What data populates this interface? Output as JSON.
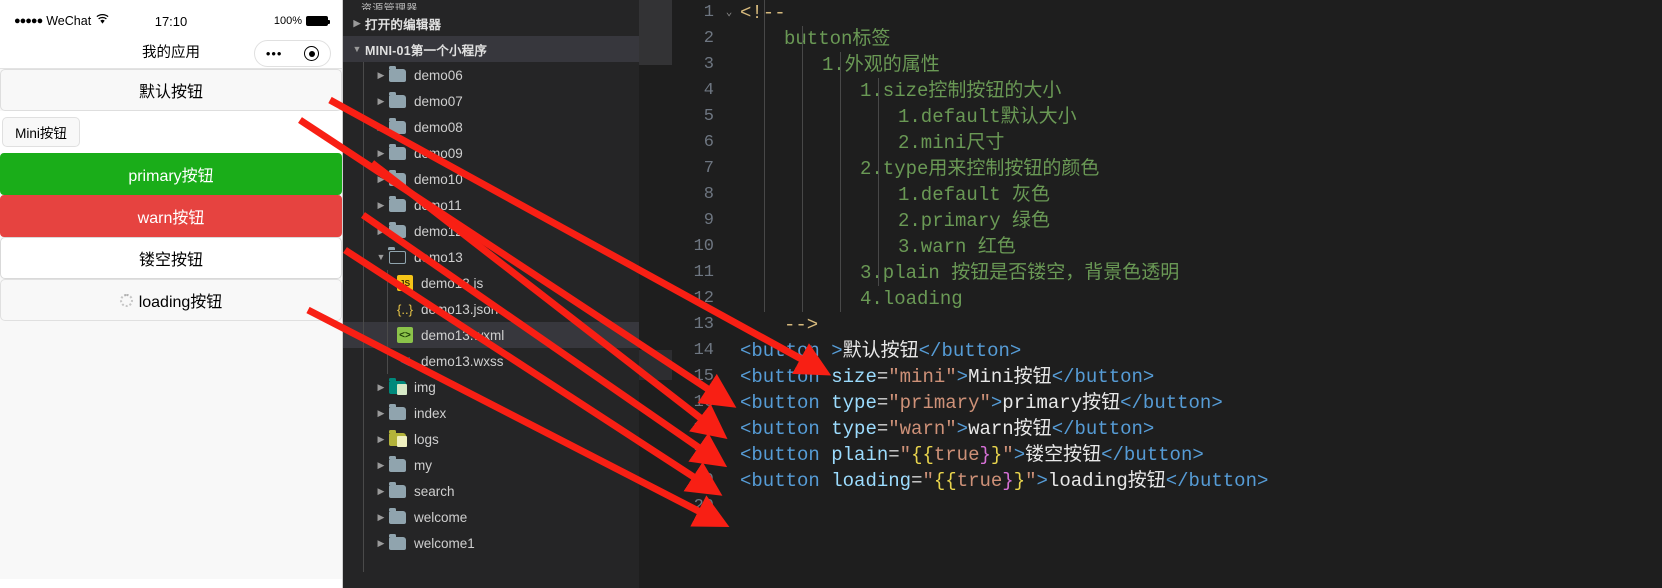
{
  "simulator": {
    "status_bar": {
      "signal_dots": "●●●●●",
      "carrier": "WeChat",
      "wifi_icon": "wifi-icon",
      "time": "17:10",
      "battery_percent": "100%"
    },
    "nav": {
      "title": "我的应用",
      "capsule_more": "•••",
      "capsule_target": "target-icon"
    },
    "buttons": [
      {
        "name": "default",
        "label": "默认按钮",
        "style": "default-btn"
      },
      {
        "name": "mini",
        "label": "Mini按钮",
        "style": "mini"
      },
      {
        "name": "primary",
        "label": "primary按钮",
        "style": "primary"
      },
      {
        "name": "warn",
        "label": "warn按钮",
        "style": "warn"
      },
      {
        "name": "plain",
        "label": "镂空按钮",
        "style": "plain"
      },
      {
        "name": "loading",
        "label": "loading按钮",
        "style": "loading"
      }
    ]
  },
  "explorer": {
    "panel_title": "资源管理器",
    "sections": [
      {
        "label": "打开的编辑器",
        "expanded": false
      },
      {
        "label": "MINI-01第一个小程序",
        "expanded": true
      }
    ],
    "tree": [
      {
        "label": "demo06",
        "type": "folder",
        "expanded": false,
        "depth": 1,
        "icon": "folder-icon"
      },
      {
        "label": "demo07",
        "type": "folder",
        "expanded": false,
        "depth": 1,
        "icon": "folder-icon"
      },
      {
        "label": "demo08",
        "type": "folder",
        "expanded": false,
        "depth": 1,
        "icon": "folder-icon"
      },
      {
        "label": "demo09",
        "type": "folder",
        "expanded": false,
        "depth": 1,
        "icon": "folder-icon"
      },
      {
        "label": "demo10",
        "type": "folder",
        "expanded": false,
        "depth": 1,
        "icon": "folder-icon"
      },
      {
        "label": "demo11",
        "type": "folder",
        "expanded": false,
        "depth": 1,
        "icon": "folder-icon"
      },
      {
        "label": "demo12",
        "type": "folder",
        "expanded": false,
        "depth": 1,
        "icon": "folder-icon"
      },
      {
        "label": "demo13",
        "type": "folder",
        "expanded": true,
        "depth": 1,
        "icon": "folder-open-icon"
      },
      {
        "label": "demo13.js",
        "type": "file",
        "filetype": "js",
        "depth": 2,
        "icon": "js-file-icon"
      },
      {
        "label": "demo13.json",
        "type": "file",
        "filetype": "json",
        "depth": 2,
        "icon": "json-file-icon"
      },
      {
        "label": "demo13.wxml",
        "type": "file",
        "filetype": "wxml",
        "depth": 2,
        "icon": "wxml-file-icon",
        "selected": true
      },
      {
        "label": "demo13.wxss",
        "type": "file",
        "filetype": "wxss",
        "depth": 2,
        "icon": "wxss-file-icon"
      },
      {
        "label": "img",
        "type": "folder",
        "expanded": false,
        "depth": 1,
        "icon": "folder-image-icon"
      },
      {
        "label": "index",
        "type": "folder",
        "expanded": false,
        "depth": 1,
        "icon": "folder-icon"
      },
      {
        "label": "logs",
        "type": "folder",
        "expanded": false,
        "depth": 1,
        "icon": "folder-log-icon"
      },
      {
        "label": "my",
        "type": "folder",
        "expanded": false,
        "depth": 1,
        "icon": "folder-icon"
      },
      {
        "label": "search",
        "type": "folder",
        "expanded": false,
        "depth": 1,
        "icon": "folder-icon"
      },
      {
        "label": "welcome",
        "type": "folder",
        "expanded": false,
        "depth": 1,
        "icon": "folder-icon"
      },
      {
        "label": "welcome1",
        "type": "folder",
        "expanded": false,
        "depth": 1,
        "icon": "folder-icon"
      }
    ]
  },
  "editor": {
    "lines": [
      {
        "n": "1",
        "fold": "v"
      },
      {
        "n": "2",
        "fold": ""
      },
      {
        "n": "3",
        "fold": ""
      },
      {
        "n": "4",
        "fold": ""
      },
      {
        "n": "5",
        "fold": ""
      },
      {
        "n": "6",
        "fold": ""
      },
      {
        "n": "7",
        "fold": ""
      },
      {
        "n": "8",
        "fold": ""
      },
      {
        "n": "9",
        "fold": ""
      },
      {
        "n": "10",
        "fold": ""
      },
      {
        "n": "11",
        "fold": ""
      },
      {
        "n": "12",
        "fold": ""
      },
      {
        "n": "13",
        "fold": ""
      },
      {
        "n": "14",
        "fold": ""
      },
      {
        "n": "15",
        "fold": ""
      },
      {
        "n": "16",
        "fold": ""
      },
      {
        "n": "17",
        "fold": ""
      },
      {
        "n": "18",
        "fold": ""
      },
      {
        "n": "19",
        "fold": ""
      },
      {
        "n": "20",
        "fold": ""
      }
    ],
    "code": {
      "l1": "<!--",
      "l2": "button标签",
      "l3": "1.外观的属性",
      "l4": "1.size控制按钮的大小",
      "l5": "1.default默认大小",
      "l6": "2.mini尺寸",
      "l7": "2.type用来控制按钮的颜色",
      "l8": "1.default 灰色",
      "l9": "2.primary 绿色",
      "l10": "3.warn 红色",
      "l11": "3.plain 按钮是否镂空，背景色透明",
      "l12": "4.loading",
      "l13": "-->",
      "l14_tag_open": "<button",
      "l14_gt": ">",
      "l14_text": "默认按钮",
      "l14_close": "</button>",
      "l15_tag_open": "<button",
      "l15_attr": "size",
      "l15_eq": "=",
      "l15_val": "\"mini\"",
      "l15_gt": ">",
      "l15_text": "Mini按钮",
      "l15_close": "</button>",
      "l16_tag_open": "<button",
      "l16_attr": "type",
      "l16_eq": "=",
      "l16_val": "\"primary\"",
      "l16_gt": ">",
      "l16_text": "primary按钮",
      "l16_close": "</button>",
      "l17_tag_open": "<button",
      "l17_attr": "type",
      "l17_eq": "=",
      "l17_val": "\"warn\"",
      "l17_gt": ">",
      "l17_text": "warn按钮",
      "l17_close": "</button>",
      "l18_tag_open": "<button",
      "l18_attr": "plain",
      "l18_eq": "=",
      "l18_q1": "\"",
      "l18_b1": "{{",
      "l18_v": "true",
      "l18_b2": "}",
      "l18_b3": "}",
      "l18_q2": "\"",
      "l18_gt": ">",
      "l18_text": "镂空按钮",
      "l18_close": "</button>",
      "l19_tag_open": "<button",
      "l19_attr": "loading",
      "l19_eq": "=",
      "l19_q1": "\"",
      "l19_b1": "{{",
      "l19_v": "true",
      "l19_b2": "}",
      "l19_b3": "}",
      "l19_q2": "\"",
      "l19_gt": ">",
      "l19_text": "loading按钮",
      "l19_close": "</button>"
    }
  },
  "annotations": {
    "arrow_color": "#f81f14",
    "count": 6,
    "description": "红色箭头，从代码行指向模拟器中对应的按钮"
  },
  "colors": {
    "primary_green": "#1aad19",
    "warn_red": "#e64340",
    "editor_bg": "#1e1e1e",
    "explorer_bg": "#252526",
    "comment_green": "#6a9955",
    "tag_blue": "#569cd6",
    "attr_blue": "#9cdcfe",
    "string_salmon": "#ce9178"
  }
}
